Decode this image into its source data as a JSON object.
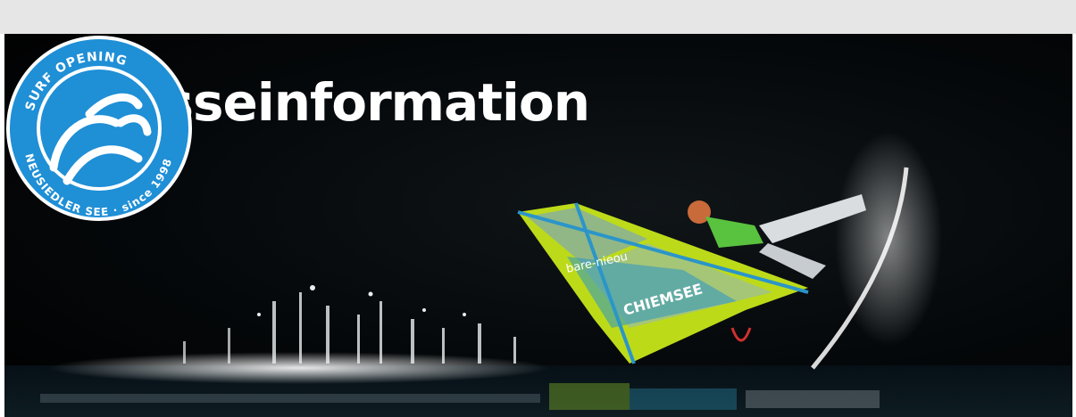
{
  "banner": {
    "title": "Presseinformation",
    "logo": {
      "top_text": "SURF OPENING",
      "bottom_text": "NEUSIEDLER SEE · since 1998",
      "color": "#1f8fd6"
    },
    "sail_texts": [
      "bare-nieou",
      "CHIEMSEE"
    ],
    "accent_color": "#b7e000"
  }
}
